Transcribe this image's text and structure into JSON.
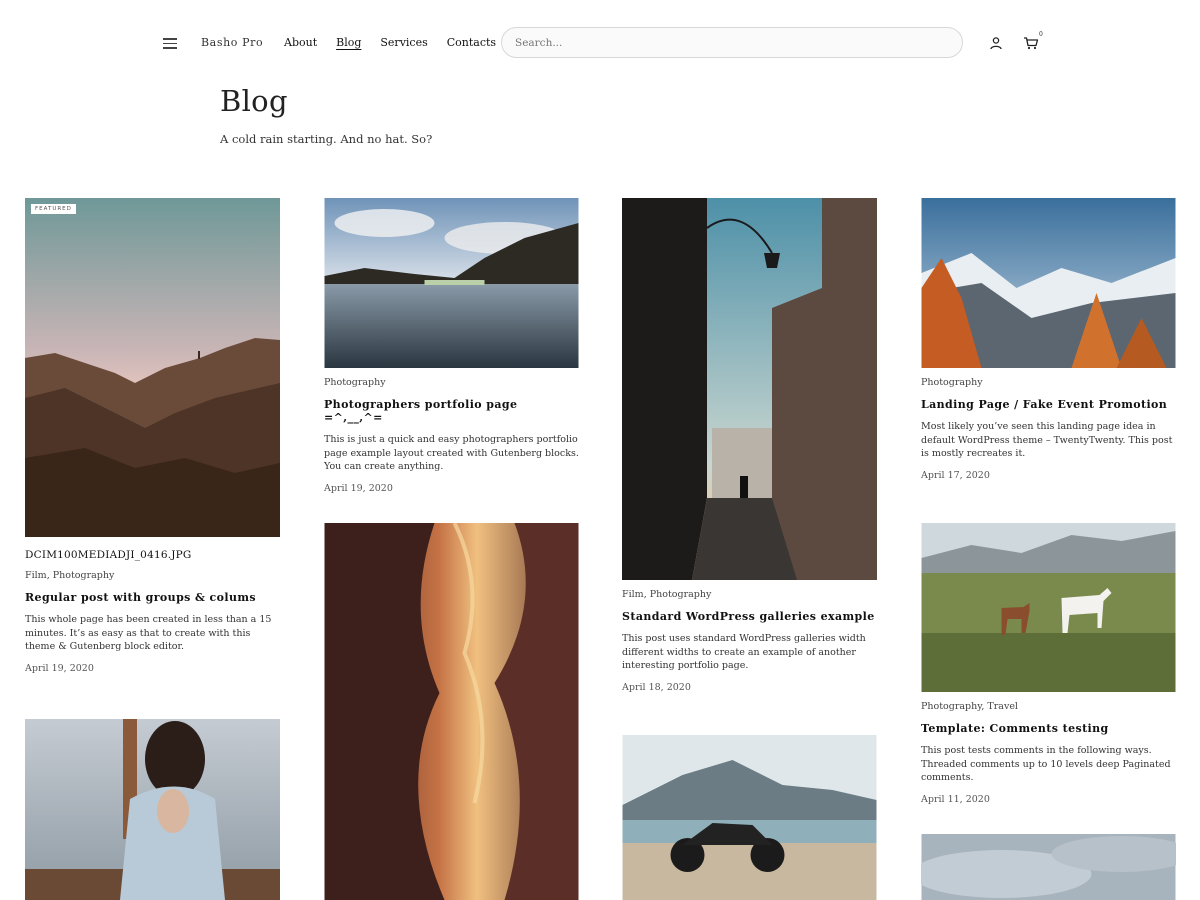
{
  "header": {
    "site_title": "Basho Pro",
    "nav": [
      {
        "label": "About"
      },
      {
        "label": "Blog",
        "active": true
      },
      {
        "label": "Services"
      },
      {
        "label": "Contacts"
      }
    ],
    "search_placeholder": "Search...",
    "cart_count": "0",
    "icons": [
      "menu-icon",
      "user-icon",
      "cart-icon"
    ]
  },
  "page": {
    "title": "Blog",
    "subtitle": "A cold rain starting. And no hat. So?"
  },
  "posts": [
    {
      "badge": "FEATURED",
      "image": "rocky cliffs at dusk",
      "caption": "DCIM100MEDIADJI_0416.JPG",
      "categories": [
        "Film",
        "Photography"
      ],
      "title": "Regular post with groups & colums",
      "excerpt": "This whole page has been created in less than a 15 minutes. It’s as easy as that to create with this theme & Gutenberg block editor.",
      "date": "April 19, 2020"
    },
    {
      "image": "mountain lake",
      "categories": [
        "Photography"
      ],
      "title": "Photographers portfolio page =^,__,^=",
      "excerpt": "This is just a quick and easy photographers portfolio page example layout created with Gutenberg blocks. You can create anything.",
      "date": "April 19, 2020"
    },
    {
      "image": "narrow street with lamp",
      "categories": [
        "Film",
        "Photography"
      ],
      "title": "Standard WordPress galleries example",
      "excerpt": "This post uses standard WordPress galleries width different widths to create an example of another interesting portfolio page.",
      "date": "April 18, 2020"
    },
    {
      "image": "autumn mountains",
      "categories": [
        "Photography"
      ],
      "title": "Landing Page / Fake Event Promotion",
      "excerpt": "Most likely you’ve seen this landing page idea in default WordPress theme – TwentyTwenty. This post is mostly recreates it.",
      "date": "April 17, 2020"
    },
    {
      "image": "horses on mountain meadow",
      "categories": [
        "Photography",
        "Travel"
      ],
      "title": "Template: Comments testing",
      "excerpt": "This post tests comments in the following ways. Threaded comments up to 10 levels deep Paginated comments.",
      "date": "April 11, 2020"
    },
    {
      "image": "woman in robe"
    },
    {
      "image": "slot canyon"
    },
    {
      "image": "motorcycle by lake"
    },
    {
      "image": "cloudy sky"
    }
  ],
  "colors": {
    "text": "#222222",
    "search_border": "#d8d8d8",
    "background": "#ffffff"
  }
}
